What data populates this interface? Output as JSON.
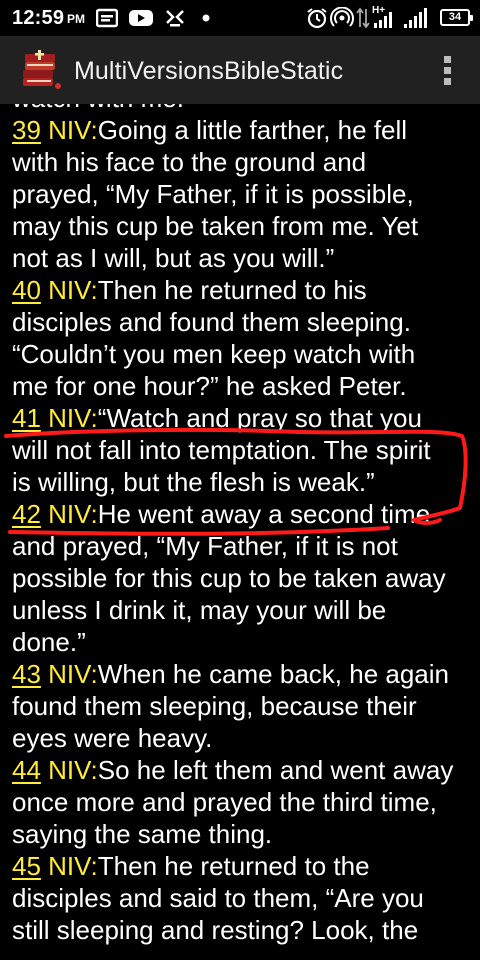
{
  "status_bar": {
    "time": "12:59",
    "ampm": "PM",
    "battery": "34",
    "network": "H+"
  },
  "app_bar": {
    "title": "MultiVersionsBibleStatic"
  },
  "passage": {
    "intro_lines": [
      "watch with me.”"
    ],
    "verses": [
      {
        "number": "39",
        "version": "NIV",
        "separator": ":",
        "lines": [
          "Going a little farther, he fell",
          "with his face to the ground and",
          "prayed, “My Father, if it is possible,",
          "may this cup be taken from me. Yet",
          "not as I will, but as you will.”"
        ]
      },
      {
        "number": "40",
        "version": "NIV",
        "separator": ":",
        "lines": [
          "Then he returned to his",
          "disciples and found them sleeping.",
          "“Couldn’t you men keep watch with",
          "me for one hour?” he asked Peter."
        ]
      },
      {
        "number": "41",
        "version": "NIV",
        "separator": ":",
        "lines": [
          "“Watch and pray so that you",
          "will not fall into temptation. The spirit",
          "is willing, but the flesh is weak.”"
        ]
      },
      {
        "number": "42",
        "version": "NIV",
        "separator": ":",
        "lines": [
          "He went away a second time",
          "and prayed, “My Father, if it is not",
          "possible for this cup to be taken away",
          "unless I drink it, may your will be",
          "done.”"
        ]
      },
      {
        "number": "43",
        "version": "NIV",
        "separator": ":",
        "lines": [
          "When he came back, he again",
          "found them sleeping, because their",
          "eyes were heavy."
        ]
      },
      {
        "number": "44",
        "version": "NIV",
        "separator": ":",
        "lines": [
          "So he left them and went away",
          "once more and prayed the third time,",
          "saying the same thing."
        ]
      },
      {
        "number": "45",
        "version": "NIV",
        "separator": ":",
        "lines": [
          "Then he returned to the",
          "disciples and said to them, “Are you",
          "still sleeping and resting? Look, the"
        ]
      }
    ]
  },
  "colors": {
    "background": "#000000",
    "app_bar": "#212121",
    "verse_reference": "#ffeb3b",
    "text": "#ffffff",
    "annotation": "#ff1a1a"
  },
  "icons": {
    "app": "bible-app-icon",
    "menu": "overflow-menu-icon"
  }
}
